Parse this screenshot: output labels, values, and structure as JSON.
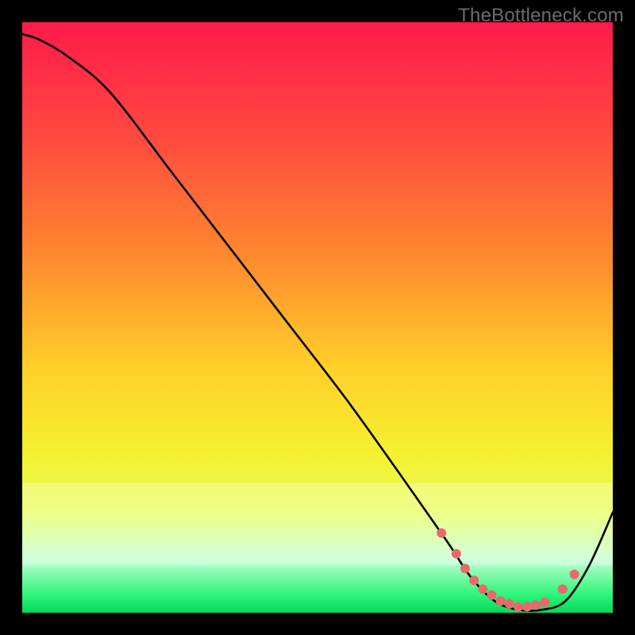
{
  "watermark": "TheBottleneck.com",
  "chart_data": {
    "type": "line",
    "title": "",
    "xlabel": "",
    "ylabel": "",
    "xlim": [
      0,
      100
    ],
    "ylim": [
      0,
      100
    ],
    "grid": false,
    "legend": false,
    "series": [
      {
        "name": "bottleneck-curve",
        "x": [
          0,
          3,
          8,
          15,
          25,
          35,
          45,
          55,
          65,
          72,
          76,
          80,
          84,
          88,
          92,
          96,
          100
        ],
        "y": [
          98,
          97,
          94,
          88,
          75,
          62,
          49,
          36,
          22,
          12,
          6,
          2,
          0.5,
          0.5,
          2,
          8,
          17
        ]
      }
    ],
    "background_gradient": {
      "stops": [
        {
          "offset": 0.0,
          "color": "#ff1a4b"
        },
        {
          "offset": 0.2,
          "color": "#ff4b3f"
        },
        {
          "offset": 0.4,
          "color": "#ff8a2e"
        },
        {
          "offset": 0.58,
          "color": "#ffce2a"
        },
        {
          "offset": 0.72,
          "color": "#f6ee2e"
        },
        {
          "offset": 0.83,
          "color": "#e6ff55"
        },
        {
          "offset": 0.91,
          "color": "#bfffd0"
        },
        {
          "offset": 0.97,
          "color": "#2cf57a"
        },
        {
          "offset": 1.0,
          "color": "#08d65a"
        }
      ]
    },
    "markers": {
      "name": "trough-dots",
      "color": "#e86a6a",
      "radius": 6,
      "x": [
        71,
        73.5,
        75,
        76.5,
        78,
        79.5,
        81,
        82.5,
        84,
        85.5,
        87,
        88.5,
        91.5,
        93.5
      ],
      "y": [
        13.5,
        10,
        7.5,
        5.5,
        4,
        3,
        2,
        1.5,
        1,
        1,
        1.3,
        1.8,
        4,
        6.5
      ]
    }
  }
}
